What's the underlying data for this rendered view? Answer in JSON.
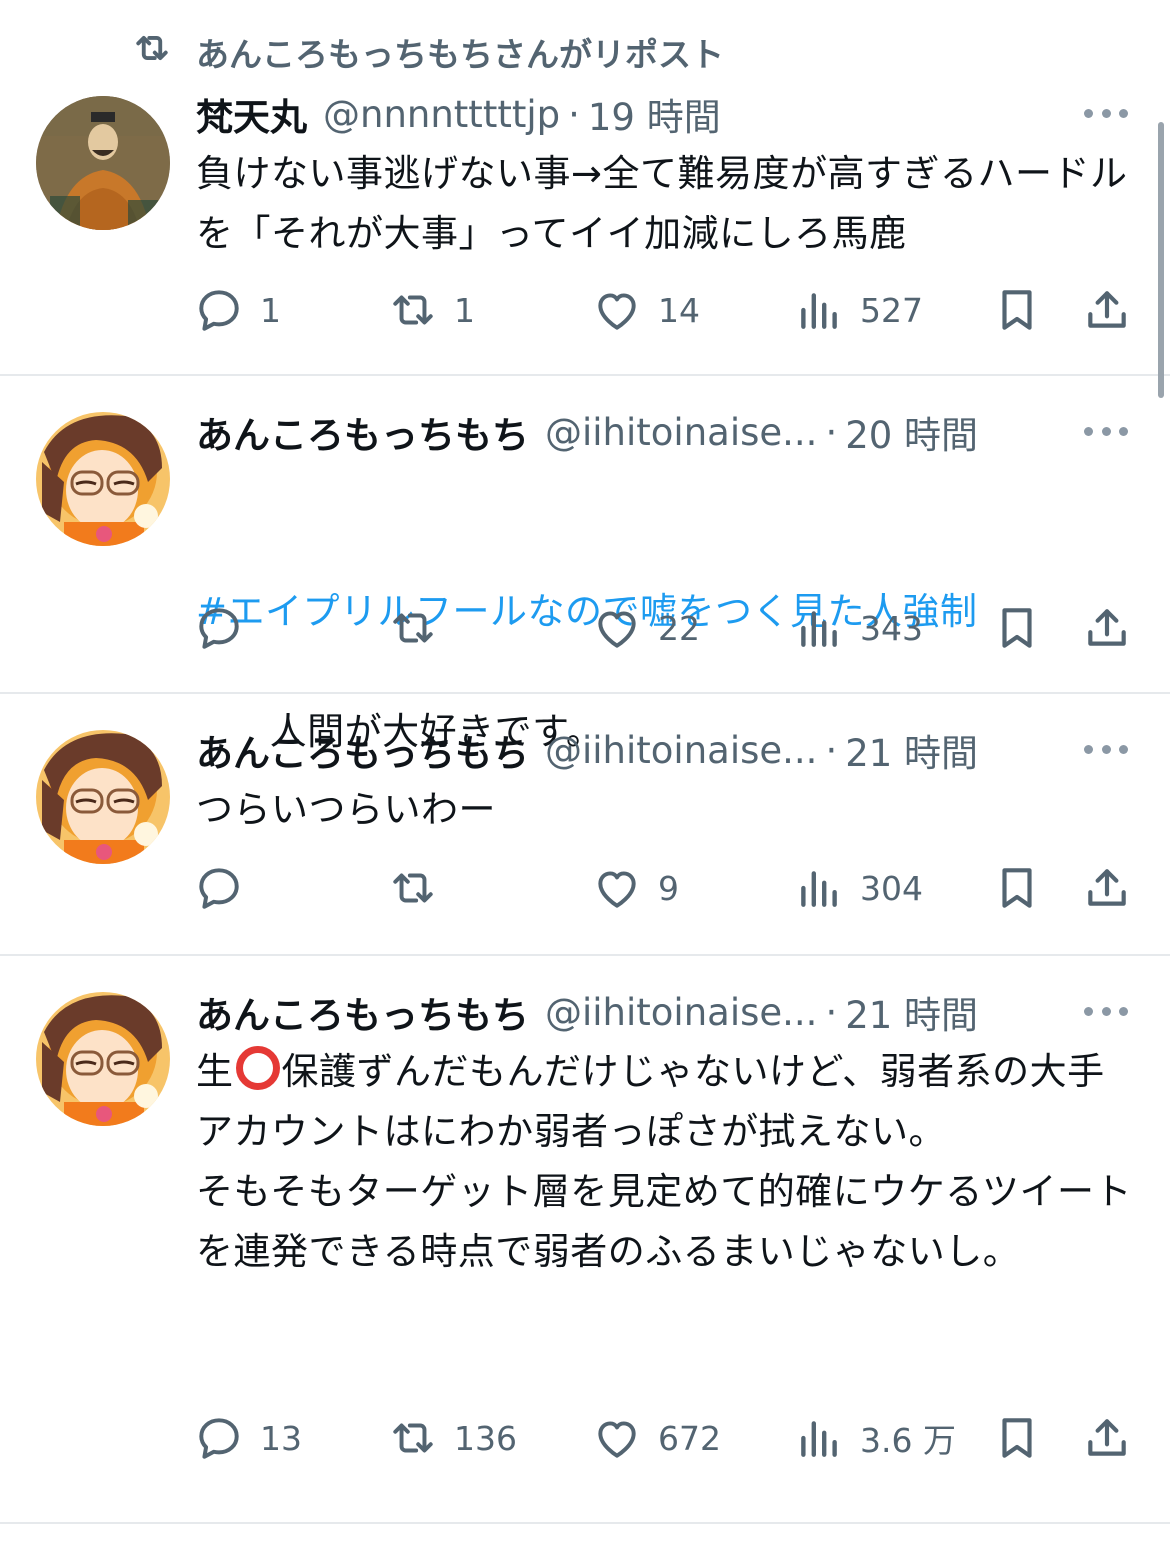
{
  "repost_banner": {
    "text": "あんころもっちもちさんがリポスト"
  },
  "tweets": [
    {
      "name": "梵天丸",
      "handle": "@nnnntttttjp",
      "dot": "·",
      "time": "19 時間",
      "text": "負けない事逃げない事→全て難易度が高すぎるハードルを「それが大事」ってイイ加減にしろ馬鹿",
      "replies": "1",
      "reposts": "1",
      "likes": "14",
      "views": "527",
      "avatar": "emperor-portrait"
    },
    {
      "name": "あんころもっちもち",
      "handle": "@iihitoinaise...",
      "dot": "·",
      "time": "20 時間",
      "hashtag": "#エイプリルフールなので嘘をつく見た人強制",
      "text": "人間が大好きです。",
      "replies": "",
      "reposts": "",
      "likes": "22",
      "views": "343",
      "avatar": "anime-girl-glasses"
    },
    {
      "name": "あんころもっちもち",
      "handle": "@iihitoinaise...",
      "dot": "·",
      "time": "21 時間",
      "text": "つらいつらいわー",
      "replies": "",
      "reposts": "",
      "likes": "9",
      "views": "304",
      "avatar": "anime-girl-glasses"
    },
    {
      "name": "あんころもっちもち",
      "handle": "@iihitoinaise...",
      "dot": "·",
      "time": "21 時間",
      "text_before_emoji": "生",
      "emoji": "red-circle",
      "text": "保護ずんだもんだけじゃないけど、弱者系の大手アカウントはにわか弱者っぽさが拭えない。\nそもそもターゲット層を見定めて的確にウケるツイートを連発できる時点で弱者のふるまいじゃないし。",
      "replies": "13",
      "reposts": "136",
      "likes": "672",
      "views": "3.6 万",
      "avatar": "anime-girl-glasses"
    }
  ],
  "colors": {
    "text": "#0f1419",
    "secondary": "#536471",
    "link": "#1d9bf0",
    "divider": "#e6e9ec",
    "emoji_red": "#e53935"
  },
  "icons": [
    "repost-icon",
    "reply-icon",
    "heart-icon",
    "views-icon",
    "bookmark-icon",
    "share-icon",
    "more-icon"
  ]
}
